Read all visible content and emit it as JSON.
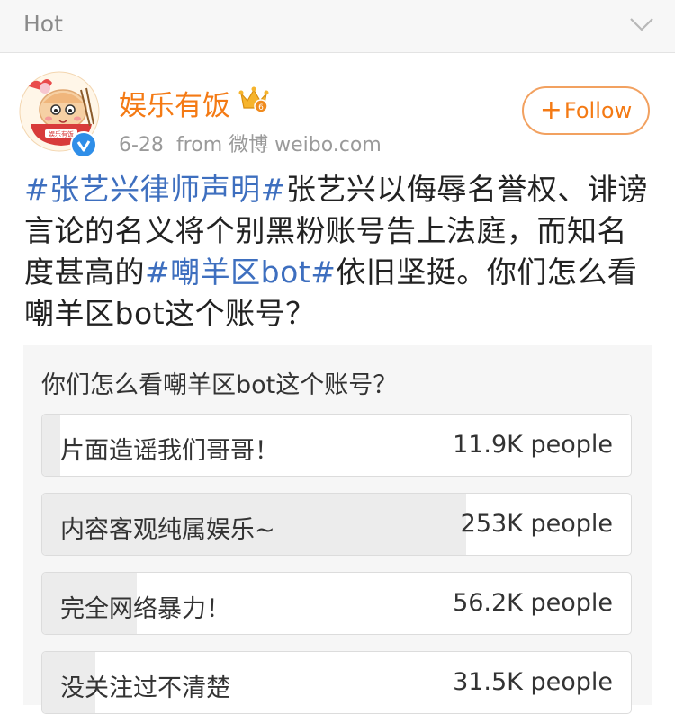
{
  "header": {
    "title": "Hot",
    "icon": "chevron-down-icon"
  },
  "post": {
    "author": {
      "name": "娱乐有饭",
      "avatar_icon": "cartoon-rice-bowl-avatar",
      "verified_icon": "verified-v-badge",
      "member_icon": "crown-badge-icon"
    },
    "date": "6-28",
    "source": "from 微博 weibo.com",
    "follow_label": "Follow",
    "text_segments": [
      {
        "text": "#张艺兴律师声明#",
        "type": "topic"
      },
      {
        "text": "张艺兴以侮辱名誉权、诽谤言论的名义将个别黑粉账号告上法庭，而知名度甚高的",
        "type": "text"
      },
      {
        "text": "#嘲羊区bot#",
        "type": "topic"
      },
      {
        "text": "依旧坚挺。你们怎么看嘲羊区bot这个账号？",
        "type": "text"
      }
    ]
  },
  "poll": {
    "question": "你们怎么看嘲羊区bot这个账号？",
    "options": [
      {
        "label": "片面造谣我们哥哥！",
        "count": "11.9K people",
        "share": 0.03
      },
      {
        "label": "内容客观纯属娱乐~",
        "count": "253K people",
        "share": 0.72
      },
      {
        "label": "完全网络暴力！",
        "count": "56.2K people",
        "share": 0.16
      },
      {
        "label": "没关注过不清楚",
        "count": "31.5K people",
        "share": 0.09
      }
    ]
  },
  "colors": {
    "accent": "#f47a14",
    "topic": "#3e6fbf",
    "verified": "#2f8ee8"
  }
}
